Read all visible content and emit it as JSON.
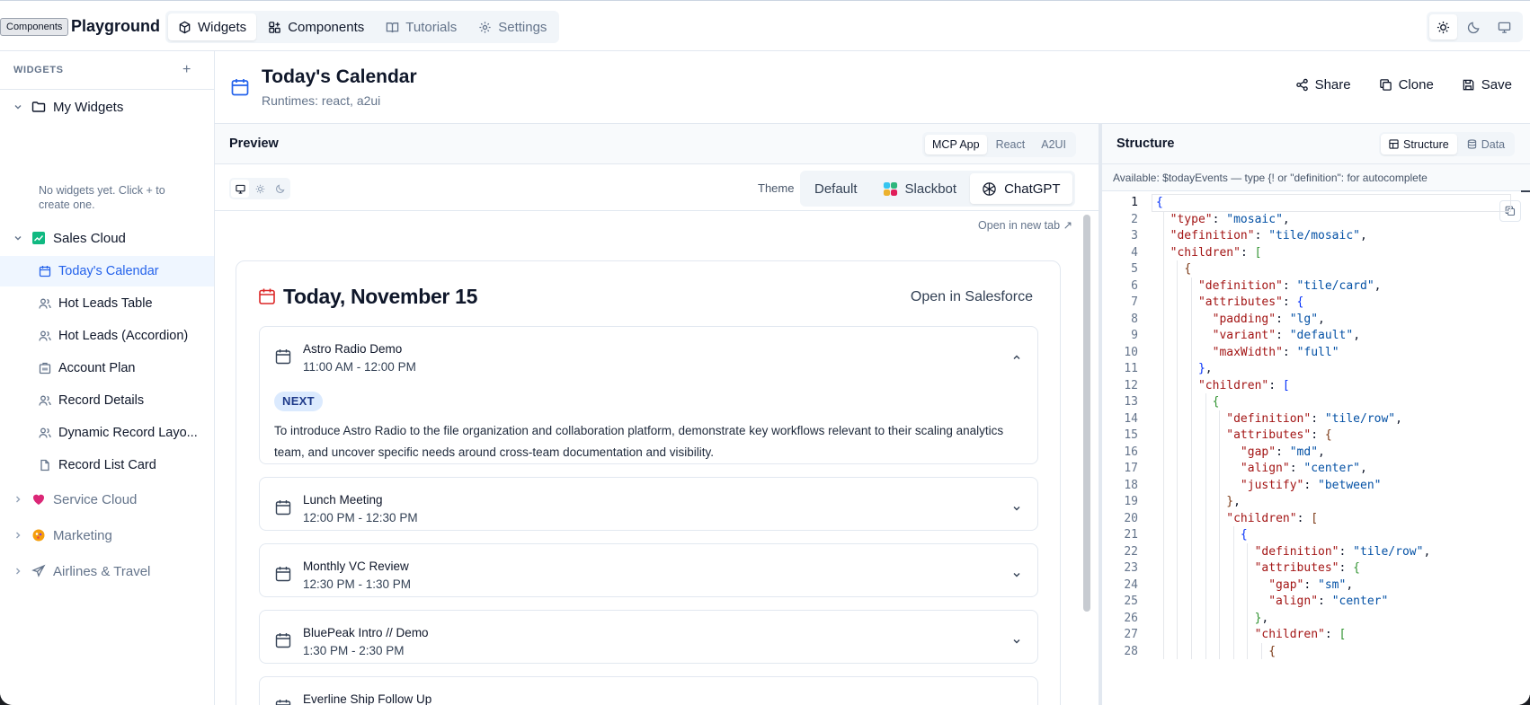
{
  "topbar": {
    "tooltip": "Components",
    "app_title": "Playground",
    "tabs": [
      {
        "label": "Widgets",
        "icon": "cube-icon"
      },
      {
        "label": "Components",
        "icon": "components-icon"
      },
      {
        "label": "Tutorials",
        "icon": "book-icon"
      },
      {
        "label": "Settings",
        "icon": "gear-icon"
      }
    ],
    "theme_options": [
      "light",
      "dark",
      "system"
    ]
  },
  "sidebar": {
    "header": "WIDGETS",
    "add_label": "+",
    "groups": [
      {
        "label": "My Widgets",
        "expanded": true,
        "icon": "folder-icon"
      },
      {
        "label": "Sales Cloud",
        "expanded": true,
        "icon": "sales-cloud-icon"
      },
      {
        "label": "Service Cloud",
        "expanded": false,
        "icon": "heart-icon"
      },
      {
        "label": "Marketing",
        "expanded": false,
        "icon": "marketing-icon"
      },
      {
        "label": "Airlines & Travel",
        "expanded": false,
        "icon": "plane-icon"
      }
    ],
    "empty_note": "No widgets yet. Click + to create one.",
    "items": [
      {
        "label": "Today's Calendar",
        "icon": "calendar-icon",
        "active": true
      },
      {
        "label": "Hot Leads Table",
        "icon": "users-icon"
      },
      {
        "label": "Hot Leads (Accordion)",
        "icon": "users-icon"
      },
      {
        "label": "Account Plan",
        "icon": "building-icon"
      },
      {
        "label": "Record Details",
        "icon": "users-icon"
      },
      {
        "label": "Dynamic Record Layo...",
        "icon": "users-icon"
      },
      {
        "label": "Record List Card",
        "icon": "file-icon"
      }
    ]
  },
  "header": {
    "title": "Today's Calendar",
    "subtitle": "Runtimes: react, a2ui",
    "actions": [
      "Share",
      "Clone",
      "Save"
    ]
  },
  "preview": {
    "title": "Preview",
    "runtime_tabs": [
      "MCP App",
      "React",
      "A2UI"
    ],
    "runtime_active": "MCP App",
    "theme_label": "Theme",
    "themes": [
      "Default",
      "Slackbot",
      "ChatGPT"
    ],
    "theme_active": "ChatGPT",
    "open_new_tab": "Open in new tab ↗",
    "calendar": {
      "title": "Today, November 15",
      "open_sf": "Open in Salesforce",
      "events": [
        {
          "name": "Astro Radio Demo",
          "time": "11:00 AM - 12:00 PM",
          "expanded": true,
          "badge": "NEXT",
          "description": "To introduce Astro Radio to the file organization and collaboration platform, demonstrate key workflows relevant to their scaling analytics team, and uncover specific needs around cross-team documentation and visibility."
        },
        {
          "name": "Lunch Meeting",
          "time": "12:00 PM - 12:30 PM",
          "expanded": false
        },
        {
          "name": "Monthly VC Review",
          "time": "12:30 PM - 1:30 PM",
          "expanded": false
        },
        {
          "name": "BluePeak Intro // Demo",
          "time": "1:30 PM - 2:30 PM",
          "expanded": false
        },
        {
          "name": "Everline Ship Follow Up",
          "time": "",
          "expanded": false
        }
      ]
    }
  },
  "structure": {
    "title": "Structure",
    "tabs": [
      "Structure",
      "Data"
    ],
    "tab_active": "Structure",
    "hint": "Available: $todayEvents — type {! or \"definition\": for autocomplete",
    "lines": [
      "{",
      "  \"type\": \"mosaic\",",
      "  \"definition\": \"tile/mosaic\",",
      "  \"children\": [",
      "    {",
      "      \"definition\": \"tile/card\",",
      "      \"attributes\": {",
      "        \"padding\": \"lg\",",
      "        \"variant\": \"default\",",
      "        \"maxWidth\": \"full\"",
      "      },",
      "      \"children\": [",
      "        {",
      "          \"definition\": \"tile/row\",",
      "          \"attributes\": {",
      "            \"gap\": \"md\",",
      "            \"align\": \"center\",",
      "            \"justify\": \"between\"",
      "          },",
      "          \"children\": [",
      "            {",
      "              \"definition\": \"tile/row\",",
      "              \"attributes\": {",
      "                \"gap\": \"sm\",",
      "                \"align\": \"center\"",
      "              },",
      "              \"children\": [",
      "                {"
    ]
  },
  "colors": {
    "accent": "#2563eb",
    "calendar_red": "#dc2626",
    "badge_bg": "#dbeafe"
  }
}
